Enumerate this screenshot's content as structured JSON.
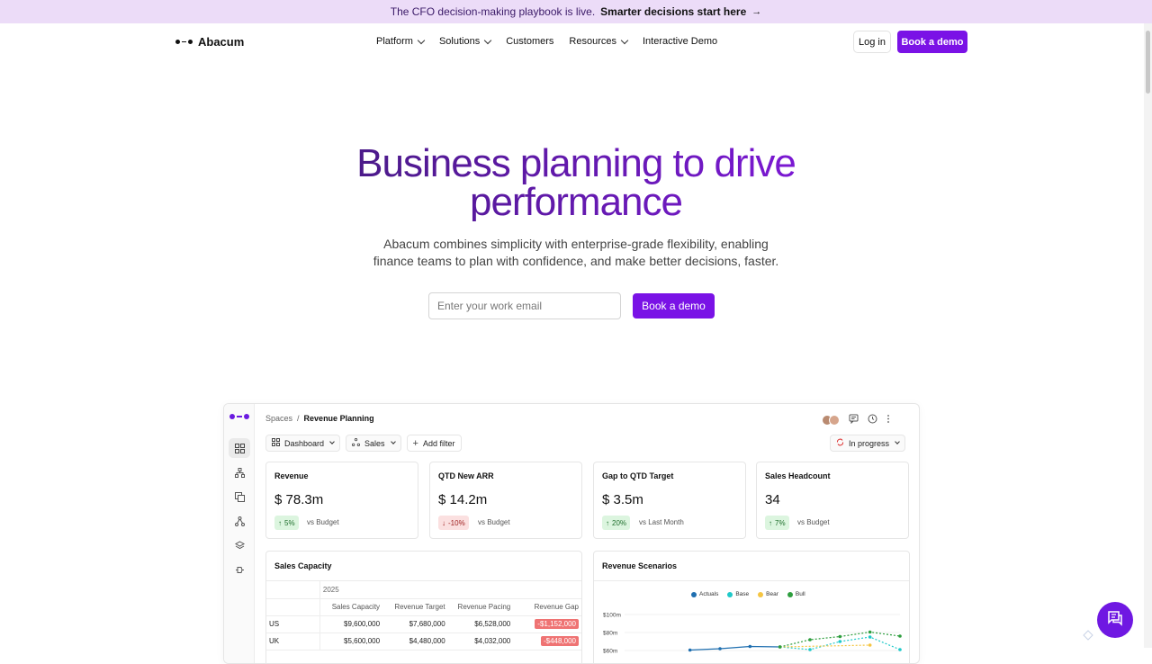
{
  "banner": {
    "text": "The CFO decision-making playbook is live.",
    "link": "Smarter decisions start here",
    "arrow": "→"
  },
  "nav": {
    "logo": "Abacum",
    "items": [
      {
        "label": "Platform",
        "dropdown": true
      },
      {
        "label": "Solutions",
        "dropdown": true
      },
      {
        "label": "Customers",
        "dropdown": false
      },
      {
        "label": "Resources",
        "dropdown": true
      },
      {
        "label": "Interactive Demo",
        "dropdown": false
      }
    ],
    "login": "Log in",
    "cta": "Book a demo"
  },
  "hero": {
    "title_line1": "Business planning to drive",
    "title_line2": "performance",
    "subtitle_line1": "Abacum combines simplicity with enterprise-grade flexibility, enabling",
    "subtitle_line2": "finance teams to plan with confidence, and make better decisions, faster.",
    "email_placeholder": "Enter your work email",
    "cta": "Book a demo"
  },
  "app": {
    "breadcrumb": {
      "root": "Spaces",
      "sep": "/",
      "current": "Revenue Planning"
    },
    "toolbar": {
      "view": "Dashboard",
      "group": "Sales",
      "filter": "Add filter",
      "status": "In progress"
    },
    "kpis": [
      {
        "label": "Revenue",
        "value": "$ 78.3m",
        "delta": "5%",
        "direction": "up",
        "compare": "vs Budget"
      },
      {
        "label": "QTD New ARR",
        "value": "$ 14.2m",
        "delta": "-10%",
        "direction": "down",
        "compare": "vs Budget"
      },
      {
        "label": "Gap to QTD Target",
        "value": "$ 3.5m",
        "delta": "20%",
        "direction": "up",
        "compare": "vs Last Month"
      },
      {
        "label": "Sales Headcount",
        "value": "34",
        "delta": "7%",
        "direction": "up",
        "compare": "vs Budget"
      }
    ],
    "capacity": {
      "title": "Sales Capacity",
      "year": "2025",
      "columns": [
        "Sales Capacity",
        "Revenue Target",
        "Revenue Pacing",
        "Revenue Gap"
      ],
      "rows": [
        {
          "name": "US",
          "values": [
            "$9,600,000",
            "$7,680,000",
            "$6,528,000",
            "-$1,152,000"
          ]
        },
        {
          "name": "UK",
          "values": [
            "$5,600,000",
            "$4,480,000",
            "$4,032,000",
            "-$448,000"
          ]
        }
      ]
    },
    "scenarios": {
      "title": "Revenue Scenarios"
    }
  },
  "chart_data": {
    "type": "line",
    "title": "Revenue Scenarios",
    "ylabel": "",
    "xlabel": "",
    "yticks": [
      "$100m",
      "$80m",
      "$60m"
    ],
    "ylim": [
      60,
      100
    ],
    "x": [
      1,
      2,
      3,
      4,
      5,
      6,
      7,
      8,
      9,
      10
    ],
    "series": [
      {
        "name": "Actuals",
        "color": "#1f6fb0",
        "values": [
          null,
          null,
          60.5,
          62,
          64.5,
          64,
          null,
          null,
          null,
          null
        ]
      },
      {
        "name": "Base",
        "color": "#1fc9c9",
        "values": [
          null,
          null,
          null,
          null,
          null,
          64,
          61,
          70,
          75,
          61
        ]
      },
      {
        "name": "Bear",
        "color": "#f5c542",
        "values": [
          null,
          null,
          null,
          null,
          null,
          64,
          null,
          null,
          66,
          null
        ]
      },
      {
        "name": "Bull",
        "color": "#2e9e3e",
        "values": [
          null,
          null,
          null,
          null,
          null,
          64,
          72,
          75.5,
          80.5,
          76
        ]
      }
    ],
    "legend": "top"
  },
  "colors": {
    "brand": "#7a12e6",
    "banner_bg": "#ecdcf8",
    "negative": "#ef7373"
  }
}
